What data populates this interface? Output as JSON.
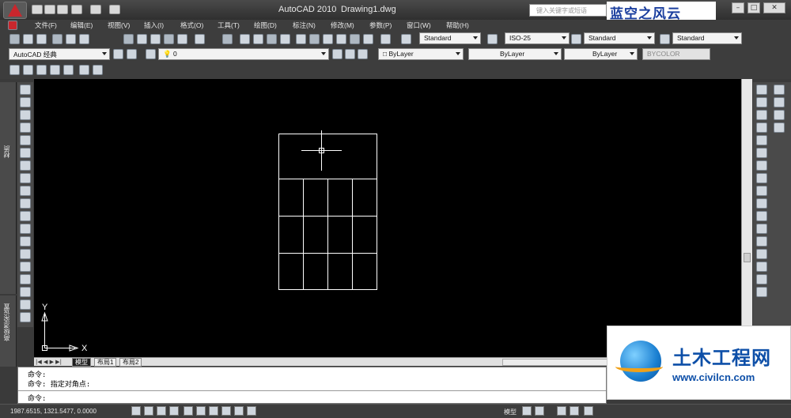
{
  "titlebar": {
    "app_name": "AutoCAD 2010",
    "file_name": "Drawing1.dwg",
    "search_placeholder": "键入关键字或短语",
    "brand_logo_text": "蓝空之风云"
  },
  "menu": [
    "文件(F)",
    "编辑(E)",
    "视图(V)",
    "插入(I)",
    "格式(O)",
    "工具(T)",
    "绘图(D)",
    "标注(N)",
    "修改(M)",
    "参数(P)",
    "窗口(W)",
    "帮助(H)"
  ],
  "styles_toolbar": {
    "text_style": "Standard",
    "dim_style": "ISO-25",
    "table_style": "Standard",
    "multileader_style": "Standard"
  },
  "workspace": {
    "name": "AutoCAD 经典",
    "layer": "0"
  },
  "properties": {
    "color": "ByLayer",
    "linetype": "ByLayer",
    "lineweight": "ByLayer",
    "plot_style": "BYCOLOR"
  },
  "side_tabs": {
    "top": "材质",
    "bottom": "高级渲染设置"
  },
  "ucs": {
    "y_label": "Y",
    "x_label": "X"
  },
  "layout_tabs": [
    "模型",
    "布局1",
    "布局2"
  ],
  "command": {
    "lines": [
      "命令:",
      "命令: 指定对角点:",
      "命令:"
    ]
  },
  "status": {
    "coordinates": "1987.6515, 1321.5477, 0.0000",
    "model_label": "模型"
  },
  "watermark": {
    "title": "土木工程网",
    "url": "www.civilcn.com"
  },
  "colors": {
    "viewport_bg": "#000000",
    "ui_bg": "#3d3d3d",
    "drawing_line": "#ffffff",
    "brand_blue": "#1a3e9e"
  }
}
